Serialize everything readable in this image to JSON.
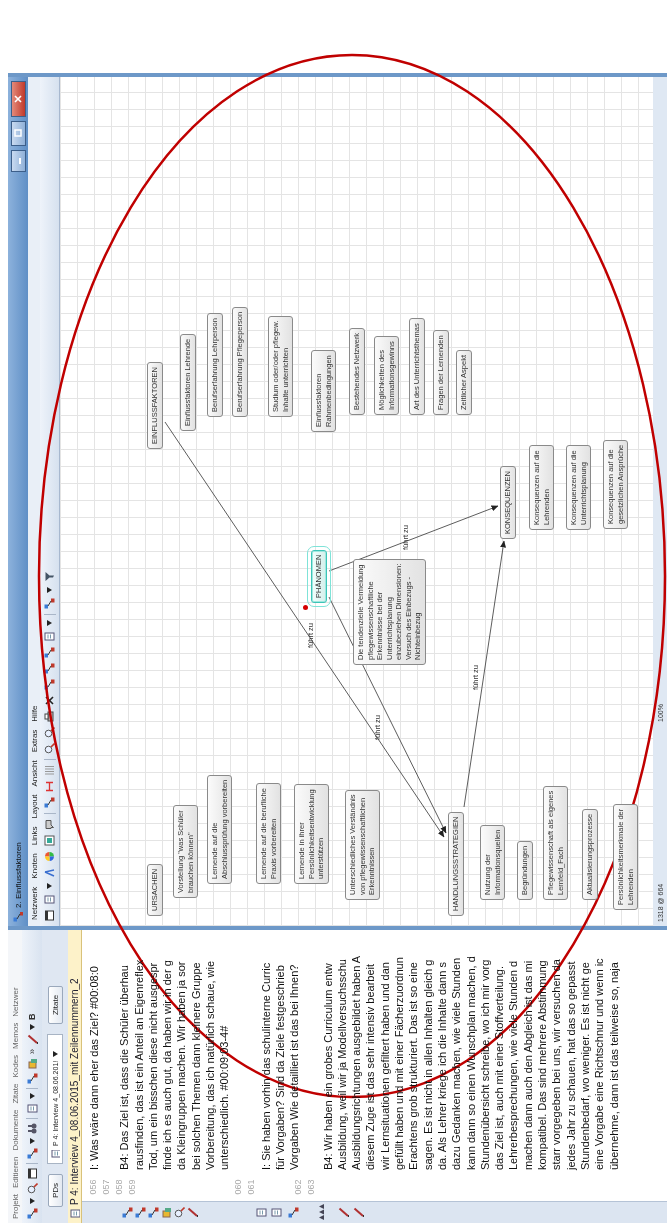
{
  "main_window": {
    "menu": [
      "Projekt",
      "Editieren",
      "Dokumente",
      "Zitate",
      "Kodes",
      "Memos",
      "Netzwer"
    ],
    "toolbar": {
      "overflow": "»",
      "format": "B"
    },
    "documents_button": "PDs",
    "document_select": "P 4: Interview 4_08.06.201!",
    "quotes_button": "Zitate",
    "document_title": "P 4: Interview 4_08.06.2015_mit Zeilennummern_2",
    "line_number_groups": [
      [
        "056",
        "057",
        "058",
        "059"
      ],
      [
        "060",
        "061"
      ],
      [
        "062",
        "063"
      ]
    ],
    "paragraphs": [
      [
        "I: Was wäre dann eher das Ziel? #00:08:0"
      ],
      [
        "B4: Das Ziel ist, dass die Schüler überhau",
        "rausfinden, das ist ein Anteil an Eigenreflex",
        "Tod, um ein bisschen diese nicht ausgespr",
        "finde ich es auch gut, da haben wir in der g",
        "da Kleingruppen machen. Wir haben ja sor",
        "bei solchen Themen dann kleinere Gruppe",
        "Vorbereitung, das ich natürlich schaue, wie",
        "unterschiedlich. #00:09:03-4#"
      ],
      [
        "I: Sie haben vorhin das schulinterne Curric",
        "für Vorgaben? Sind da Ziele festgeschrieb",
        "Vorgaben Wie detailliert ist das bei Ihnen?"
      ],
      [
        "B4: Wir haben ein grobes Curriculum entw",
        "Ausbildung, weil wir ja Modellversuchsschu",
        "Ausbildungsrichtungen ausgebildet haben A",
        "diesem Zuge ist das sehr intensiv bearbeit",
        "wir Lernsituationen gefiltert haben und dan",
        "gefüllt haben und mit einer Fächerzuordnun",
        "Erachtens grob strukturiert. Das ist so eine",
        "sagen. Es ist nicht in allen Inhalten gleich g",
        "da. Als Lehrer kriege ich die Inhalte dann s",
        "dazu Gedanken machen, wie viele Stunden",
        "kann dann so einen Wunschplan machen, d",
        "Stundenübersicht schreibe, wo ich mir vorg",
        "das Ziel ist, auch mit einer Stoffverteilung.",
        "Lehrerbesprechungen, wie viele Stunden d",
        "machen dann auch den Abgleich ist das mi",
        "kompatibel. Das sind mehrere Abstimmung",
        "starr vorgegeben bei uns, wir versuchen da",
        "jedes Jahr zu schauen, hat das so gepasst",
        "Stundenbedarf, wo weniger. Es ist nicht ge",
        "eine Vorgabe eine Richtschnur und wenn ic",
        "übernehme, dann ist das teilweise so, naja"
      ]
    ]
  },
  "network_window": {
    "title": "2. Einflussfaktoren",
    "menu": [
      "Netzwerk",
      "Knoten",
      "Links",
      "Layout",
      "Ansicht",
      "Extras",
      "Hilfe"
    ],
    "nodes": [
      {
        "lines": [
          "URSACHEN"
        ],
        "selected": false
      },
      {
        "lines": [
          "Vorstellung \"was Schüler",
          "brauchen können\""
        ],
        "selected": false
      },
      {
        "lines": [
          "Lernende auf die",
          "Abschlussprüfung vorbereiten"
        ],
        "selected": false
      },
      {
        "lines": [
          "Lernende auf die berufliche",
          "Praxis vorbereiten"
        ],
        "selected": false
      },
      {
        "lines": [
          "Lernende in ihrer",
          "Persönlichkeitsentwicklung",
          "unterstützen"
        ],
        "selected": false
      },
      {
        "lines": [
          "Unterschiedliches Verständnis",
          "von pflegewissenschaftlichen",
          "Erkenntnissen"
        ],
        "selected": false
      },
      {
        "lines": [
          "HANDLUNGSSTRATEGIEN"
        ],
        "selected": false
      },
      {
        "lines": [
          "Nutzung der",
          "Informationsquellen"
        ],
        "selected": false
      },
      {
        "lines": [
          "Begründungen"
        ],
        "selected": false
      },
      {
        "lines": [
          "Pflegewissenschaft als eigenes",
          "Lernfeld_Fach"
        ],
        "selected": false
      },
      {
        "lines": [
          "Aktualisierungsprozesse"
        ],
        "selected": false
      },
      {
        "lines": [
          "Persönlichkeitsmerkmale der",
          "Lehrenden"
        ],
        "selected": false
      },
      {
        "lines": [
          "PHÄNOMEN"
        ],
        "selected": true
      },
      {
        "lines": [
          "Die tendenzielle Vermeidung",
          "pflegewissenschaftliche",
          "Erkenntnisse bei der",
          "Unterrichtsplanung",
          "einzubeziehen Dimensionen:",
          "Versuch des Einbezugs -",
          "Nichteinbezug"
        ],
        "selected": false
      },
      {
        "lines": [
          "KONSEQUENZEN"
        ],
        "selected": false
      },
      {
        "lines": [
          "Konsequenzen auf die",
          "Lehrenden"
        ],
        "selected": false
      },
      {
        "lines": [
          "Konsequenzen auf die",
          "Unterrichtsplanung"
        ],
        "selected": false
      },
      {
        "lines": [
          "Konsequenzen auf die",
          "gesetzlichen Ansprüche"
        ],
        "selected": false
      },
      {
        "lines": [
          "EINFLUSSFAKTOREN"
        ],
        "selected": false
      },
      {
        "lines": [
          "Einflussfaktoren Lehrende"
        ],
        "selected": false
      },
      {
        "lines": [
          "Berufserfahrung Lehrperson"
        ],
        "selected": false
      },
      {
        "lines": [
          "Berufserfahrung Pflegeperson"
        ],
        "selected": false
      },
      {
        "lines": [
          "Studium oder/oder pflegew.",
          "Inhalte unterrichten"
        ],
        "selected": false
      },
      {
        "lines": [
          "Einflussfaktoren",
          "Rahmenbedingungen"
        ],
        "selected": false
      },
      {
        "lines": [
          "Bestehendes Netzwerk"
        ],
        "selected": false
      },
      {
        "lines": [
          "Möglichkeiten des",
          "Informationsgewinns"
        ],
        "selected": false
      },
      {
        "lines": [
          "Art des Unterrichtsthemas"
        ],
        "selected": false
      },
      {
        "lines": [
          "Fragen der Lernenden"
        ],
        "selected": false
      },
      {
        "lines": [
          "Zeitlicher Aspekt"
        ],
        "selected": false
      }
    ],
    "links": [
      {
        "label": "führt zu"
      },
      {
        "label": "führt zu"
      },
      {
        "label": "führt zu"
      },
      {
        "label": "führt zu"
      }
    ],
    "status": {
      "position": "1318 @ 664",
      "zoom": "100%"
    }
  }
}
